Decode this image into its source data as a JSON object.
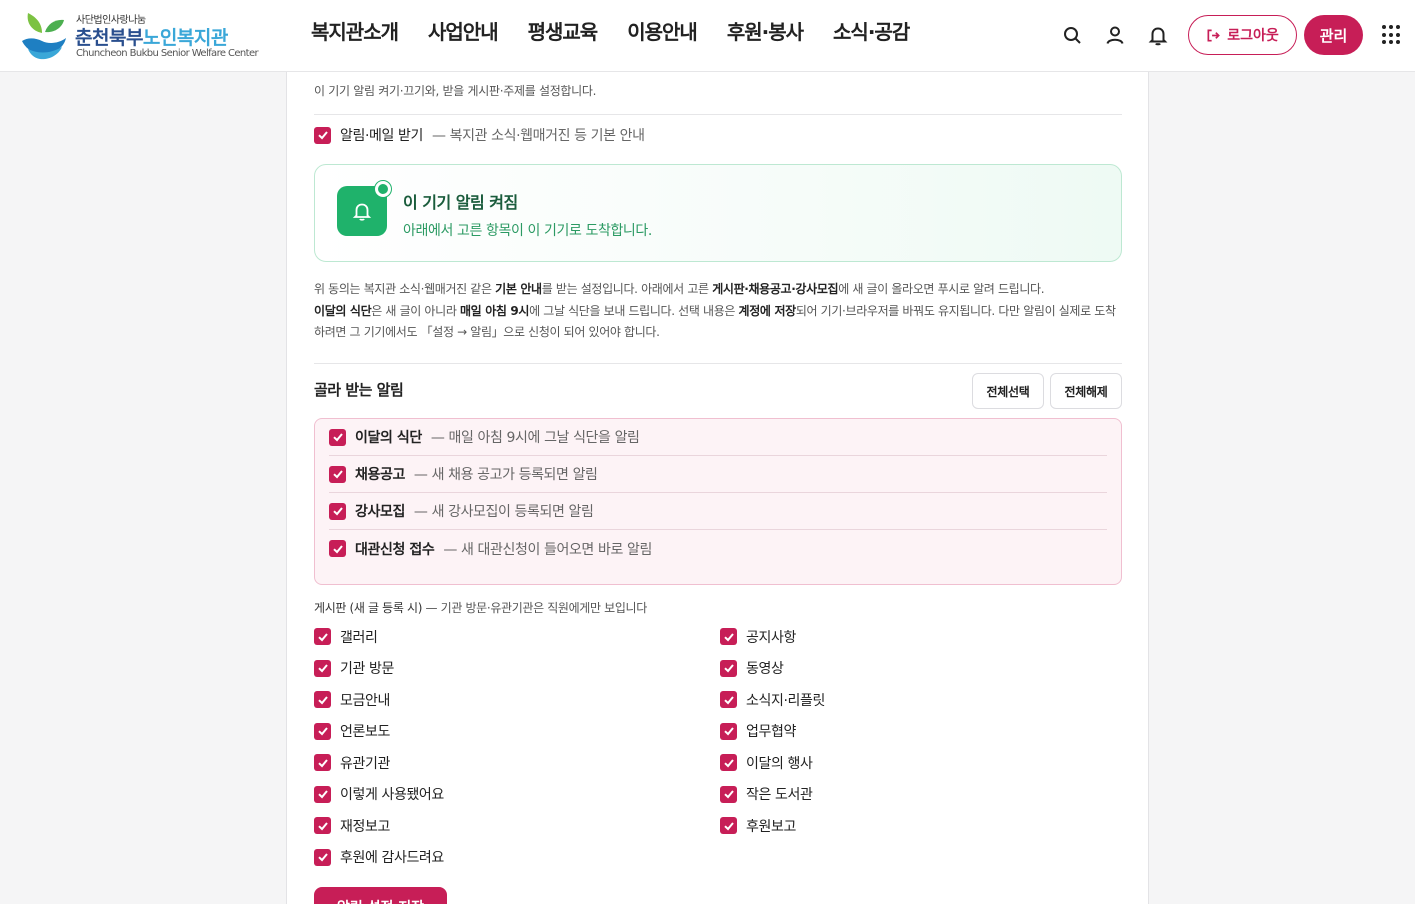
{
  "header": {
    "logo_small": "사단법인사랑나눔",
    "logo_main_a": "춘천북부",
    "logo_main_b": "노인복지관",
    "logo_en": "Chuncheon Bukbu Senior Welfare Center",
    "nav": [
      "복지관소개",
      "사업안내",
      "평생교육",
      "이용안내",
      "후원·봉사",
      "소식·공감"
    ],
    "icons": [
      "search-icon",
      "user-icon",
      "bell-icon"
    ],
    "logout_label": "로그아웃",
    "admin_label": "관리"
  },
  "panel": {
    "intro": "이 기기 알림 켜기·끄기와, 받을 게시판·주제를 설정합니다.",
    "consent": {
      "title": "알림·메일 받기",
      "desc": "— 복지관 소식·웹매거진 등 기본 안내",
      "checked": true
    },
    "status": {
      "title": "이 기기 알림 켜짐",
      "desc": "아래에서 고른 항목이 이 기기로 도착합니다."
    },
    "explain": {
      "p1": "위 동의는 복지관 소식·웹매거진 같은 ",
      "b1": "기본 안내",
      "p2": "를 받는 설정입니다. 아래에서 고른 ",
      "b2": "게시판·채용공고·강사모집",
      "p3": "에 새 글이 올라오면 푸시로 알려 드립니다.",
      "b3": "이달의 식단",
      "p4": "은 새 글이 아니라 ",
      "b4": "매일 아침 9시",
      "p5": "에 그날 식단을 보내 드립니다. 선택 내용은 ",
      "b5": "계정에 저장",
      "p6": "되어 기기·브라우저를 바꿔도 유지됩니다. 다만 알림이 실제로 도착하려면 그 기기에서도 「설정 → 알림」으로 신청이 되어 있어야 합니다."
    },
    "pick_title": "골라 받는 알림",
    "select_all": "전체선택",
    "deselect_all": "전체해제",
    "pick_items": [
      {
        "title": "이달의 식단",
        "desc": "— 매일 아침 9시에 그날 식단을 알림",
        "checked": true
      },
      {
        "title": "채용공고",
        "desc": "— 새 채용 공고가 등록되면 알림",
        "checked": true
      },
      {
        "title": "강사모집",
        "desc": "— 새 강사모집이 등록되면 알림",
        "checked": true
      },
      {
        "title": "대관신청 접수",
        "desc": "— 새 대관신청이 들어오면 바로 알림",
        "checked": true
      }
    ],
    "board_head_bold": "게시판 (새 글 등록 시)",
    "board_head_rest": " — 기관 방문·유관기관은 직원에게만 보입니다",
    "boards": [
      "갤러리",
      "공지사항",
      "기관 방문",
      "동영상",
      "모금안내",
      "소식지·리플릿",
      "언론보도",
      "업무협약",
      "유관기관",
      "이달의 행사",
      "이렇게 사용됐어요",
      "작은 도서관",
      "재정보고",
      "후원보고",
      "후원에 감사드려요"
    ],
    "save_label": "알림 설정 저장"
  },
  "colors": {
    "brand": "#c71e57",
    "green": "#1fb26b",
    "pick_bg": "#fdf3f6"
  }
}
